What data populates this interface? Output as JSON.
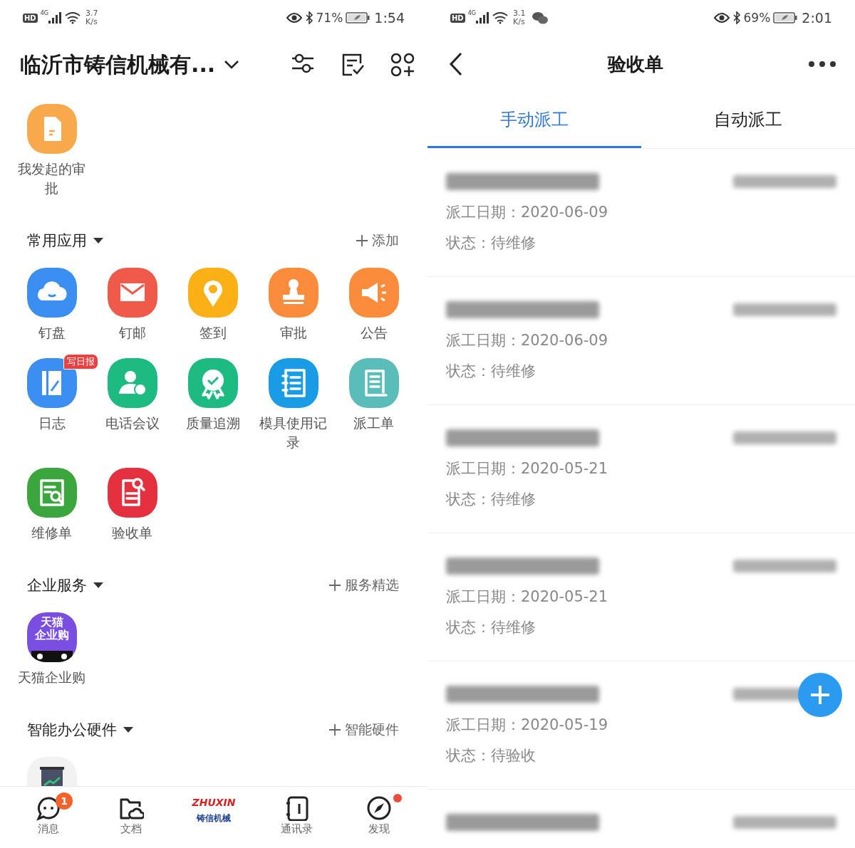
{
  "left": {
    "status_bar": {
      "hd": "HD",
      "network": "4G",
      "speed": "3.7",
      "speed_unit": "K/s",
      "battery": "71%",
      "time": "1:54"
    },
    "header": {
      "title": "临沂市铸信机械有..."
    },
    "pinned": [
      {
        "label": "我发起的审批",
        "color": "#f7a94b",
        "kind": "doc"
      }
    ],
    "sections": [
      {
        "title": "常用应用",
        "action": "添加",
        "apps": [
          {
            "label": "钉盘",
            "color": "#3b8ff3",
            "kind": "cloud"
          },
          {
            "label": "钉邮",
            "color": "#ef5a4a",
            "kind": "mail"
          },
          {
            "label": "签到",
            "color": "#fbb116",
            "kind": "pin"
          },
          {
            "label": "审批",
            "color": "#fb8c3c",
            "kind": "stamp"
          },
          {
            "label": "公告",
            "color": "#fb8c3c",
            "kind": "megaphone"
          },
          {
            "label": "日志",
            "color": "#3b8ff3",
            "kind": "journal",
            "badge": "写日报"
          },
          {
            "label": "电话会议",
            "color": "#1dbb81",
            "kind": "call"
          },
          {
            "label": "质量追溯",
            "color": "#1dbb81",
            "kind": "award"
          },
          {
            "label": "模具使用记录",
            "color": "#1a9be6",
            "kind": "notebook"
          },
          {
            "label": "派工单",
            "color": "#5bbdb9",
            "kind": "scroll"
          },
          {
            "label": "维修单",
            "color": "#3aa63d",
            "kind": "repair"
          },
          {
            "label": "验收单",
            "color": "#e5303f",
            "kind": "inspect"
          }
        ]
      },
      {
        "title": "企业服务",
        "action": "服务精选",
        "apps": [
          {
            "label": "天猫企业购",
            "color": "#7a4ee0",
            "kind": "tmall",
            "icon_text": [
              "天猫",
              "企业购"
            ]
          }
        ]
      },
      {
        "title": "智能办公硬件",
        "action": "智能硬件",
        "apps": [
          {
            "color": "#f2f2f2",
            "kind": "screen"
          }
        ]
      }
    ],
    "nav": [
      {
        "label": "消息",
        "kind": "chat",
        "badge": "1"
      },
      {
        "label": "文档",
        "kind": "folder"
      },
      {
        "label": "铸信机械",
        "kind": "logo",
        "logo_text": "ZHUXIN"
      },
      {
        "label": "通讯录",
        "kind": "contacts"
      },
      {
        "label": "发现",
        "kind": "compass",
        "dot": true
      }
    ]
  },
  "right": {
    "status_bar": {
      "hd": "HD",
      "network": "4G",
      "speed": "3.1",
      "speed_unit": "K/s",
      "battery": "69%",
      "time": "2:01"
    },
    "header": {
      "title": "验收单"
    },
    "tabs": [
      {
        "label": "手动派工",
        "selected": true
      },
      {
        "label": "自动派工",
        "selected": false
      }
    ],
    "orders": [
      {
        "date": "派工日期：2020-06-09",
        "status": "状态：待维修"
      },
      {
        "date": "派工日期：2020-06-09",
        "status": "状态：待维修"
      },
      {
        "date": "派工日期：2020-05-21",
        "status": "状态：待维修"
      },
      {
        "date": "派工日期：2020-05-21",
        "status": "状态：待维修"
      },
      {
        "date": "派工日期：2020-05-19",
        "status": "状态：待验收"
      }
    ]
  }
}
